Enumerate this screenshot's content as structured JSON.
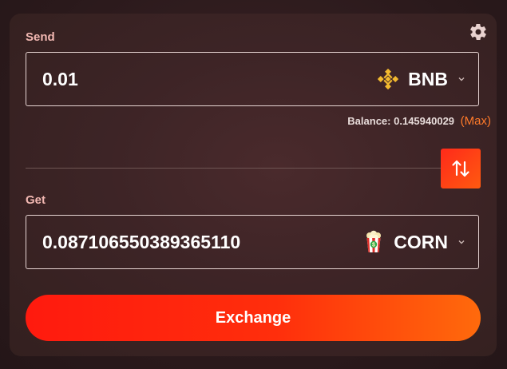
{
  "send": {
    "label": "Send",
    "amount": "0.01",
    "token": "BNB",
    "token_icon": "bnb-logo-icon",
    "balance_label": "Balance:",
    "balance_value": "0.145940029",
    "max_label": "(Max)"
  },
  "get": {
    "label": "Get",
    "amount": "0.087106550389365110",
    "token": "CORN",
    "token_icon": "popcorn-token-icon"
  },
  "swap_icon": "swap-arrows-icon",
  "settings_icon": "gear-icon",
  "exchange_label": "Exchange",
  "colors": {
    "accent": "#ff2a1a",
    "accent_secondary": "#ff6a0c",
    "max_link": "#ff7a2a",
    "bnb_yellow": "#f3ba2f"
  }
}
